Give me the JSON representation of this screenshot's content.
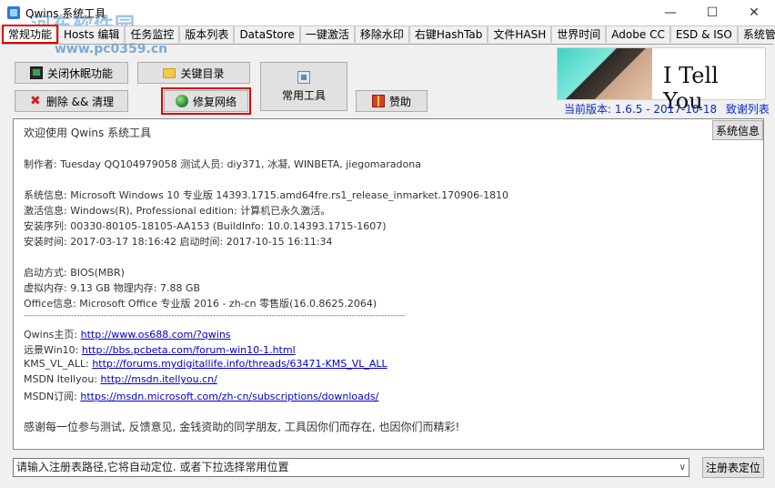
{
  "window": {
    "title": "Qwins 系统工具",
    "watermark": "河东软件园",
    "watermark_url": "www.pc0359.cn",
    "minimize": "—",
    "maximize": "☐",
    "close": "✕"
  },
  "tabs": [
    {
      "label": "常规功能"
    },
    {
      "label": "Hosts 编辑"
    },
    {
      "label": "任务监控"
    },
    {
      "label": "版本列表"
    },
    {
      "label": "DataStore"
    },
    {
      "label": "一键激活"
    },
    {
      "label": "移除水印"
    },
    {
      "label": "右键HashTab"
    },
    {
      "label": "文件HASH"
    },
    {
      "label": "世界时间"
    },
    {
      "label": "Adobe CC"
    },
    {
      "label": "ESD & ISO"
    },
    {
      "label": "系统管理"
    }
  ],
  "buttons": {
    "hibernate": "关闭休眠功能",
    "folders": "关键目录",
    "delete": "删除 && 清理",
    "repair": "修复网络",
    "tools": "常用工具",
    "donate": "赞助"
  },
  "banner": {
    "text": "I Tell You"
  },
  "version": {
    "current": "当前版本: 1.6.5 - 2017-10-18",
    "thanks": "致谢列表"
  },
  "info": {
    "sysinfo_button": "系统信息",
    "welcome": "欢迎使用 Qwins 系统工具",
    "author": "制作者: Tuesday QQ104979058 测试人员: diy371, 冰凝, WINBETA, jiegomaradona",
    "os": "系统信息: Microsoft Windows 10 专业版 14393.1715.amd64fre.rs1_release_inmarket.170906-1810",
    "activation": "激活信息: Windows(R), Professional edition:  计算机已永久激活。",
    "serial": "安装序列: 00330-80105-18105-AA153 (BuildInfo: 10.0.14393.1715-1607)",
    "install_time": "安装时间: 2017-03-17 18:16:42  启动时间: 2017-10-15 16:11:34",
    "boot": "启动方式: BIOS(MBR)",
    "memory": "虚拟内存: 9.13 GB 物理内存: 7.88 GB",
    "office": "Office信息: Microsoft Office 专业版 2016 - zh-cn 零售版(16.0.8625.2064)",
    "separator": "------------------------------------------------------------------------------------------------------------------------------------------------",
    "links": [
      {
        "label": "Qwins主页: ",
        "url": "http://www.os688.com/?qwins"
      },
      {
        "label": "远景Win10:  ",
        "url": "http://bbs.pcbeta.com/forum-win10-1.html"
      },
      {
        "label": "KMS_VL_ALL: ",
        "url": "http://forums.mydigitallife.info/threads/63471-KMS_VL_ALL"
      },
      {
        "label": "MSDN Itellyou: ",
        "url": "http://msdn.itellyou.cn/"
      },
      {
        "label": "MSDN订阅: ",
        "url": "https://msdn.microsoft.com/zh-cn/subscriptions/downloads/"
      }
    ],
    "thanks_msg": "感谢每一位参与测试, 反馈意见, 金钱资助的同学朋友, 工具因你们而存在, 也因你们而精彩!"
  },
  "bottom": {
    "path_placeholder": "请输入注册表路径,它将自动定位. 或者下拉选择常用位置",
    "dropdown_arrow": "∨",
    "locate_button": "注册表定位"
  }
}
